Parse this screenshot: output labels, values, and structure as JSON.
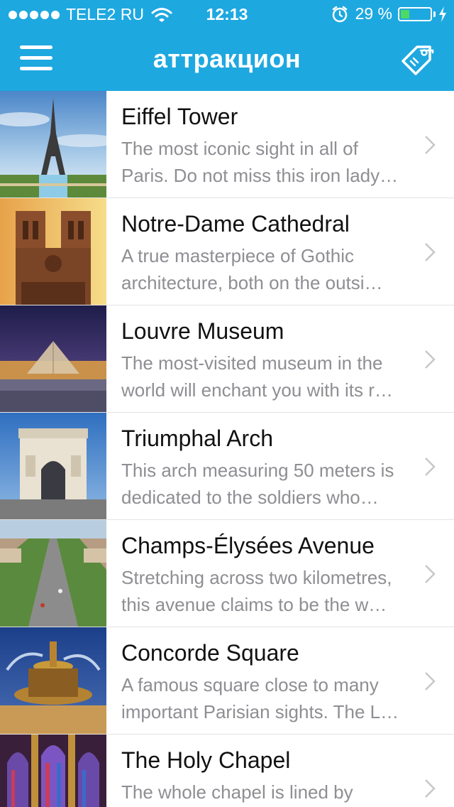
{
  "status_bar": {
    "carrier": "TELE2 RU",
    "time": "12:13",
    "battery_percent": "29 %",
    "battery_level": 0.29,
    "signal_dots": 5
  },
  "navbar": {
    "title": "аттракцион",
    "left_icon": "hamburger-menu-icon",
    "right_icon": "tag-icon"
  },
  "colors": {
    "accent": "#1ea8e0",
    "title_text": "#111111",
    "description_text": "#8e8e93",
    "battery_fill": "#4cd964"
  },
  "attractions": [
    {
      "name": "Eiffel Tower",
      "desc_line1": "The most iconic sight in all of",
      "desc_line2": "Paris. Do not miss this iron lady…"
    },
    {
      "name": "Notre-Dame Cathedral",
      "desc_line1": "A true masterpiece of Gothic",
      "desc_line2": "architecture, both on the outsi…"
    },
    {
      "name": "Louvre Museum",
      "desc_line1": "The most-visited museum in the",
      "desc_line2": "world will enchant you with its r…"
    },
    {
      "name": "Triumphal Arch",
      "desc_line1": "This arch measuring 50 meters is",
      "desc_line2": "dedicated to the soldiers who…"
    },
    {
      "name": "Champs-Élysées Avenue",
      "desc_line1": "Stretching across two kilometres,",
      "desc_line2": "this avenue claims to be the w…"
    },
    {
      "name": "Concorde Square",
      "desc_line1": "A famous square close to many",
      "desc_line2": "important Parisian sights. The L…"
    },
    {
      "name": "The Holy Chapel",
      "desc_line1": "The whole chapel is lined by",
      "desc_line2": ""
    }
  ]
}
